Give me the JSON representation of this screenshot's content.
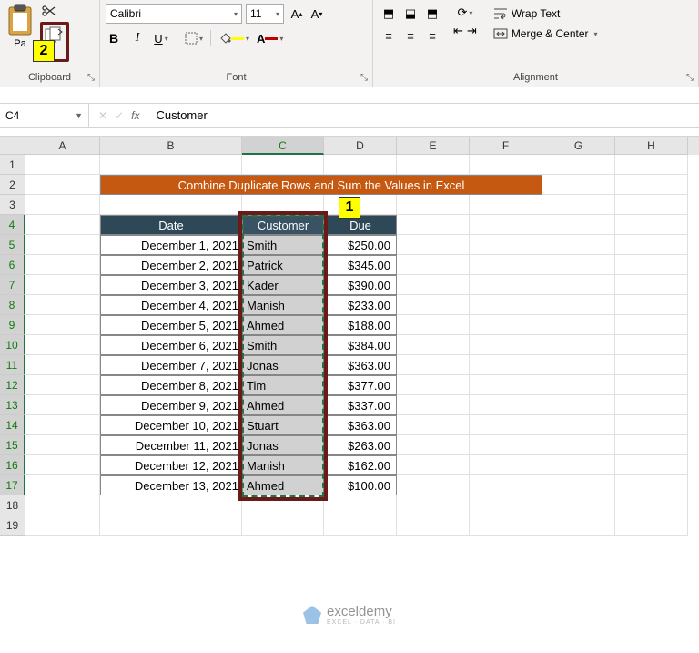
{
  "ribbon": {
    "clipboard": {
      "label": "Clipboard",
      "paste": "Pa"
    },
    "font": {
      "label": "Font",
      "name": "Calibri",
      "size": "11",
      "bold": "B",
      "italic": "I",
      "underline": "U"
    },
    "alignment": {
      "label": "Alignment",
      "wrap": "Wrap Text",
      "merge": "Merge & Center"
    }
  },
  "formula_bar": {
    "cell_ref": "C4",
    "fx": "fx",
    "value": "Customer"
  },
  "columns": [
    "A",
    "B",
    "C",
    "D",
    "E",
    "F",
    "G",
    "H"
  ],
  "title": "Combine Duplicate Rows and Sum the Values in Excel",
  "headers": {
    "date": "Date",
    "customer": "Customer",
    "due": "Due"
  },
  "rows": [
    {
      "date": "December 1, 2021",
      "customer": "Smith",
      "due": "$250.00"
    },
    {
      "date": "December 2, 2021",
      "customer": "Patrick",
      "due": "$345.00"
    },
    {
      "date": "December 3, 2021",
      "customer": "Kader",
      "due": "$390.00"
    },
    {
      "date": "December 4, 2021",
      "customer": "Manish",
      "due": "$233.00"
    },
    {
      "date": "December 5, 2021",
      "customer": "Ahmed",
      "due": "$188.00"
    },
    {
      "date": "December 6, 2021",
      "customer": "Smith",
      "due": "$384.00"
    },
    {
      "date": "December 7, 2021",
      "customer": "Jonas",
      "due": "$363.00"
    },
    {
      "date": "December 8, 2021",
      "customer": "Tim",
      "due": "$377.00"
    },
    {
      "date": "December 9, 2021",
      "customer": "Ahmed",
      "due": "$337.00"
    },
    {
      "date": "December 10, 2021",
      "customer": "Stuart",
      "due": "$363.00"
    },
    {
      "date": "December 11, 2021",
      "customer": "Jonas",
      "due": "$263.00"
    },
    {
      "date": "December 12, 2021",
      "customer": "Manish",
      "due": "$162.00"
    },
    {
      "date": "December 13, 2021",
      "customer": "Ahmed",
      "due": "$100.00"
    }
  ],
  "callouts": {
    "c1": "1",
    "c2": "2"
  },
  "watermark": {
    "brand": "exceldemy",
    "tag": "EXCEL · DATA · BI"
  },
  "chart_data": {
    "type": "table",
    "title": "Combine Duplicate Rows and Sum the Values in Excel",
    "columns": [
      "Date",
      "Customer",
      "Due"
    ],
    "data": [
      [
        "December 1, 2021",
        "Smith",
        250.0
      ],
      [
        "December 2, 2021",
        "Patrick",
        345.0
      ],
      [
        "December 3, 2021",
        "Kader",
        390.0
      ],
      [
        "December 4, 2021",
        "Manish",
        233.0
      ],
      [
        "December 5, 2021",
        "Ahmed",
        188.0
      ],
      [
        "December 6, 2021",
        "Smith",
        384.0
      ],
      [
        "December 7, 2021",
        "Jonas",
        363.0
      ],
      [
        "December 8, 2021",
        "Tim",
        377.0
      ],
      [
        "December 9, 2021",
        "Ahmed",
        337.0
      ],
      [
        "December 10, 2021",
        "Stuart",
        363.0
      ],
      [
        "December 11, 2021",
        "Jonas",
        263.0
      ],
      [
        "December 12, 2021",
        "Manish",
        162.0
      ],
      [
        "December 13, 2021",
        "Ahmed",
        100.0
      ]
    ]
  }
}
